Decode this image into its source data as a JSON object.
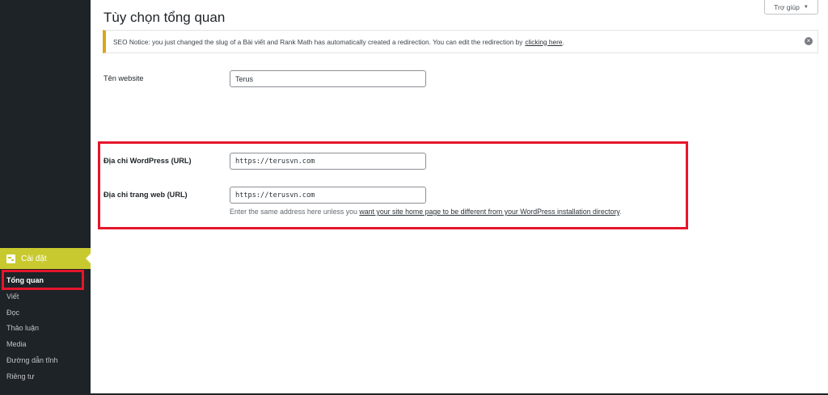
{
  "sidebar": {
    "active_menu": {
      "label": "Cài đặt",
      "icon": "settings-icon"
    },
    "submenu": [
      {
        "label": "Tổng quan",
        "current": true
      },
      {
        "label": "Viết",
        "current": false
      },
      {
        "label": "Đọc",
        "current": false
      },
      {
        "label": "Thảo luận",
        "current": false
      },
      {
        "label": "Media",
        "current": false
      },
      {
        "label": "Đường dẫn tĩnh",
        "current": false
      },
      {
        "label": "Riêng tư",
        "current": false
      }
    ]
  },
  "header": {
    "title": "Tùy chọn tổng quan",
    "help_label": "Trợ giúp"
  },
  "notice": {
    "text": "SEO Notice: you just changed the slug of a Bài viết and Rank Math has automatically created a redirection. You can edit the redirection by",
    "link_text": "clicking here",
    "end": "."
  },
  "form": {
    "site_title": {
      "label": "Tên website",
      "value": "Terus"
    },
    "wp_url": {
      "label": "Địa chỉ WordPress (URL)",
      "value": "https://terusvn.com"
    },
    "site_url": {
      "label": "Địa chỉ trang web (URL)",
      "value": "https://terusvn.com"
    },
    "site_url_desc": {
      "text": "Enter the same address here unless you",
      "link_text": "want your site home page to be different from your WordPress installation directory",
      "end": "."
    }
  },
  "colors": {
    "sidebar_bg": "#1d2327",
    "active_menu_bg": "#c8c92e",
    "notice_border": "#dba617",
    "highlight": "#e5162b"
  }
}
